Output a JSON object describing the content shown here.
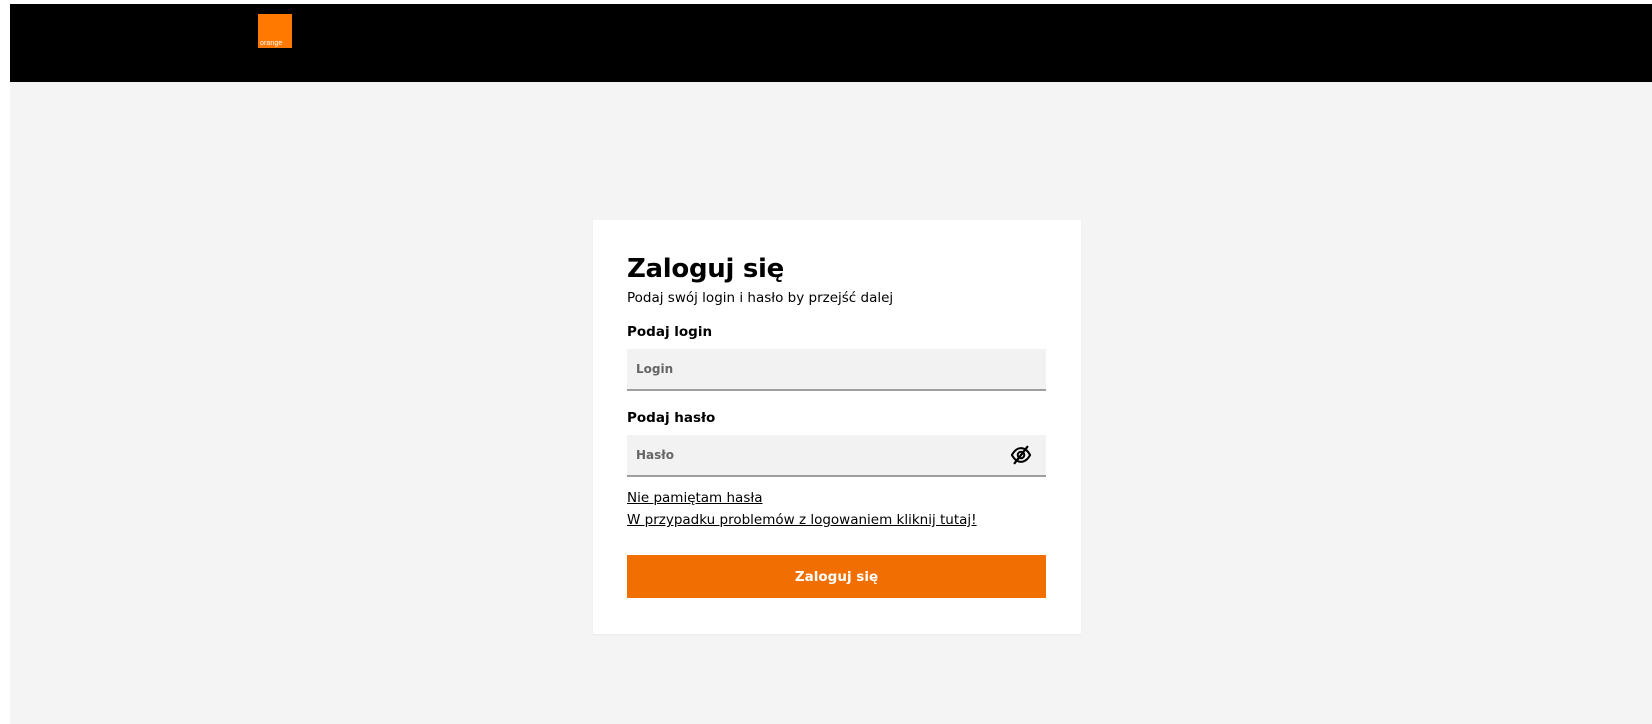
{
  "header": {
    "logo_text": "orange",
    "brand_color": "#ff7900",
    "background_color": "#000000"
  },
  "login_card": {
    "title": "Zaloguj się",
    "subtitle": "Podaj swój login i hasło by przejść dalej",
    "login_label": "Podaj login",
    "login_placeholder": "Login",
    "login_value": "",
    "password_label": "Podaj hasło",
    "password_placeholder": "Hasło",
    "password_value": "",
    "toggle_password_icon": "eye-slash-icon",
    "forgot_password_link": "Nie pamiętam hasła",
    "help_link": "W przypadku problemów z logowaniem kliknij tutaj!",
    "submit_label": "Zaloguj się",
    "submit_color": "#f16e00"
  }
}
